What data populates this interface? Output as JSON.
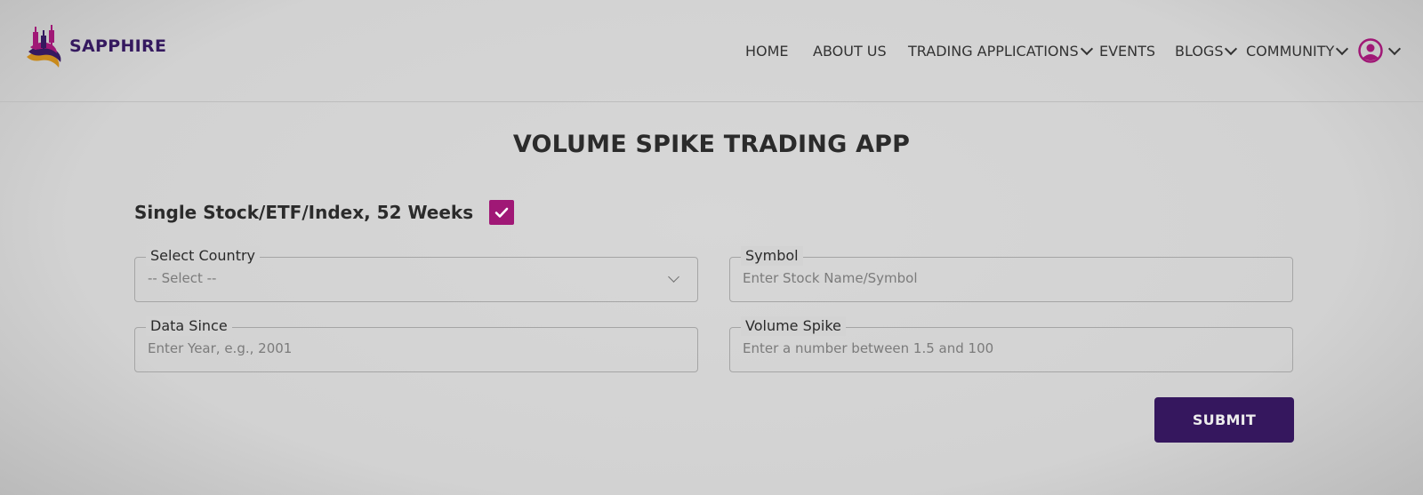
{
  "brand": {
    "name": "SAPPHIRE",
    "colors": {
      "primary": "#35195f",
      "accent": "#a01876",
      "gold": "#c98a1c"
    }
  },
  "nav": {
    "items": [
      {
        "label": "HOME",
        "has_dropdown": false
      },
      {
        "label": "ABOUT US",
        "has_dropdown": false
      },
      {
        "label": "TRADING APPLICATIONS",
        "has_dropdown": true
      },
      {
        "label": "EVENTS",
        "has_dropdown": false
      },
      {
        "label": "BLOGS",
        "has_dropdown": true
      },
      {
        "label": "COMMUNITY",
        "has_dropdown": true
      }
    ],
    "user_icon": "user-circle-icon"
  },
  "page": {
    "title": "VOLUME SPIKE TRADING APP",
    "mode_label": "Single Stock/ETF/Index, 52 Weeks",
    "mode_checked": true
  },
  "form": {
    "country": {
      "label": "Select Country",
      "value": "-- Select --"
    },
    "symbol": {
      "label": "Symbol",
      "placeholder": "Enter Stock Name/Symbol"
    },
    "data_since": {
      "label": "Data Since",
      "placeholder": "Enter Year, e.g., 2001"
    },
    "volume_spike": {
      "label": "Volume Spike",
      "placeholder": "Enter a number between 1.5 and 100"
    },
    "submit_label": "SUBMIT"
  }
}
